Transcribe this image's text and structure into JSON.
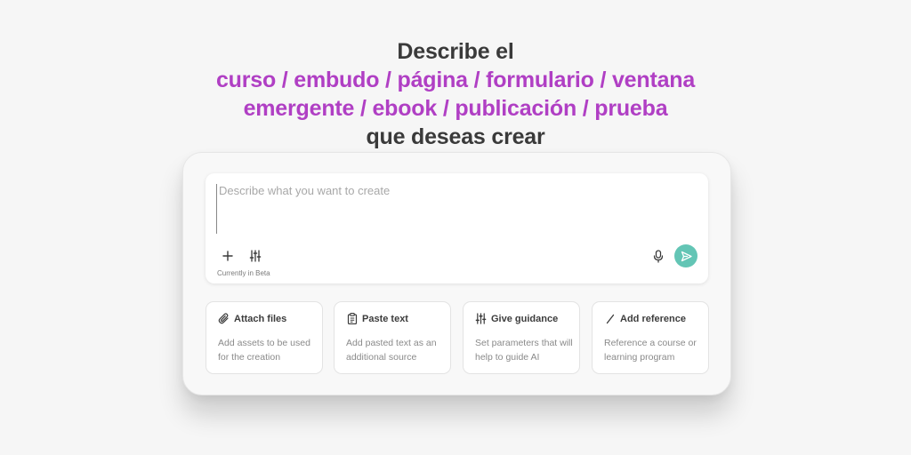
{
  "headline": {
    "line1": "Describe el",
    "line2": "curso / embudo / página / formulario / ventana",
    "line3": "emergente / ebook / publicación / prueba",
    "line4": "que deseas crear",
    "accent_color": "#b03fc4",
    "dark_color": "#3a3a3a"
  },
  "prompt": {
    "placeholder": "Describe what you want to create",
    "value": "",
    "beta_label": "Currently in Beta",
    "icons": {
      "add": "plus-icon",
      "settings": "sliders-icon",
      "mic": "microphone-icon",
      "send": "send-icon"
    },
    "send_color": "#63c5b5"
  },
  "options": [
    {
      "title": "Attach files",
      "description": "Add assets to be used for the creation",
      "icon": "paperclip-icon"
    },
    {
      "title": "Paste text",
      "description": "Add pasted text as an additional source",
      "icon": "clipboard-icon"
    },
    {
      "title": "Give guidance",
      "description": "Set parameters that will help to guide AI",
      "icon": "sliders-icon"
    },
    {
      "title": "Add reference",
      "description": "Reference a course or learning program",
      "icon": "slash-icon"
    }
  ]
}
